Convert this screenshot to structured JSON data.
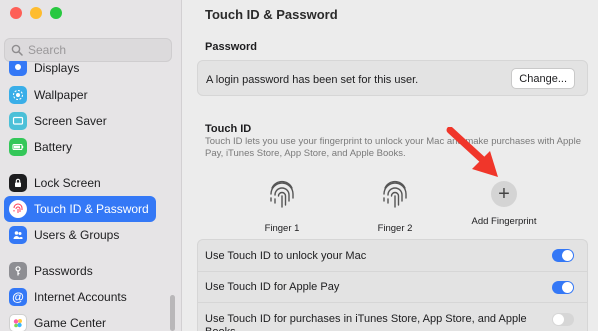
{
  "window": {
    "controls": [
      "close",
      "minimize",
      "zoom"
    ]
  },
  "search": {
    "placeholder": "Search"
  },
  "sidebar": {
    "items": [
      {
        "label": "Displays",
        "icon": "displays-icon",
        "color": "#3478f6"
      },
      {
        "label": "Wallpaper",
        "icon": "wallpaper-icon",
        "color": "#3aaee8"
      },
      {
        "label": "Screen Saver",
        "icon": "screen-saver-icon",
        "color": "#4cc0d8"
      },
      {
        "label": "Battery",
        "icon": "battery-icon",
        "color": "#34c759"
      },
      {
        "label": "Lock Screen",
        "icon": "lock-screen-icon",
        "color": "#1d1d1f"
      },
      {
        "label": "Touch ID & Password",
        "icon": "fingerprint-icon",
        "color": "#ff3b58",
        "selected": true
      },
      {
        "label": "Users & Groups",
        "icon": "users-icon",
        "color": "#3478f6"
      },
      {
        "label": "Passwords",
        "icon": "key-icon",
        "color": "#8e8e93"
      },
      {
        "label": "Internet Accounts",
        "icon": "at-icon",
        "color": "#3478f6"
      },
      {
        "label": "Game Center",
        "icon": "game-center-icon",
        "color": "#ffffff"
      }
    ]
  },
  "main": {
    "title": "Touch ID & Password",
    "password": {
      "heading": "Password",
      "text": "A login password has been set for this user.",
      "button": "Change..."
    },
    "touchid": {
      "heading": "Touch ID",
      "description": "Touch ID lets you use your fingerprint to unlock your Mac and make purchases with Apple Pay, iTunes Store, App Store, and Apple Books.",
      "fingers": [
        "Finger 1",
        "Finger 2"
      ],
      "add_label": "Add Fingerprint"
    },
    "options": [
      {
        "label": "Use Touch ID to unlock your Mac",
        "on": true
      },
      {
        "label": "Use Touch ID for Apple Pay",
        "on": true
      },
      {
        "label": "Use Touch ID for purchases in iTunes Store, App Store, and Apple Books",
        "on": false
      }
    ]
  },
  "colors": {
    "accent": "#3478f6",
    "arrow": "#f0362a"
  }
}
